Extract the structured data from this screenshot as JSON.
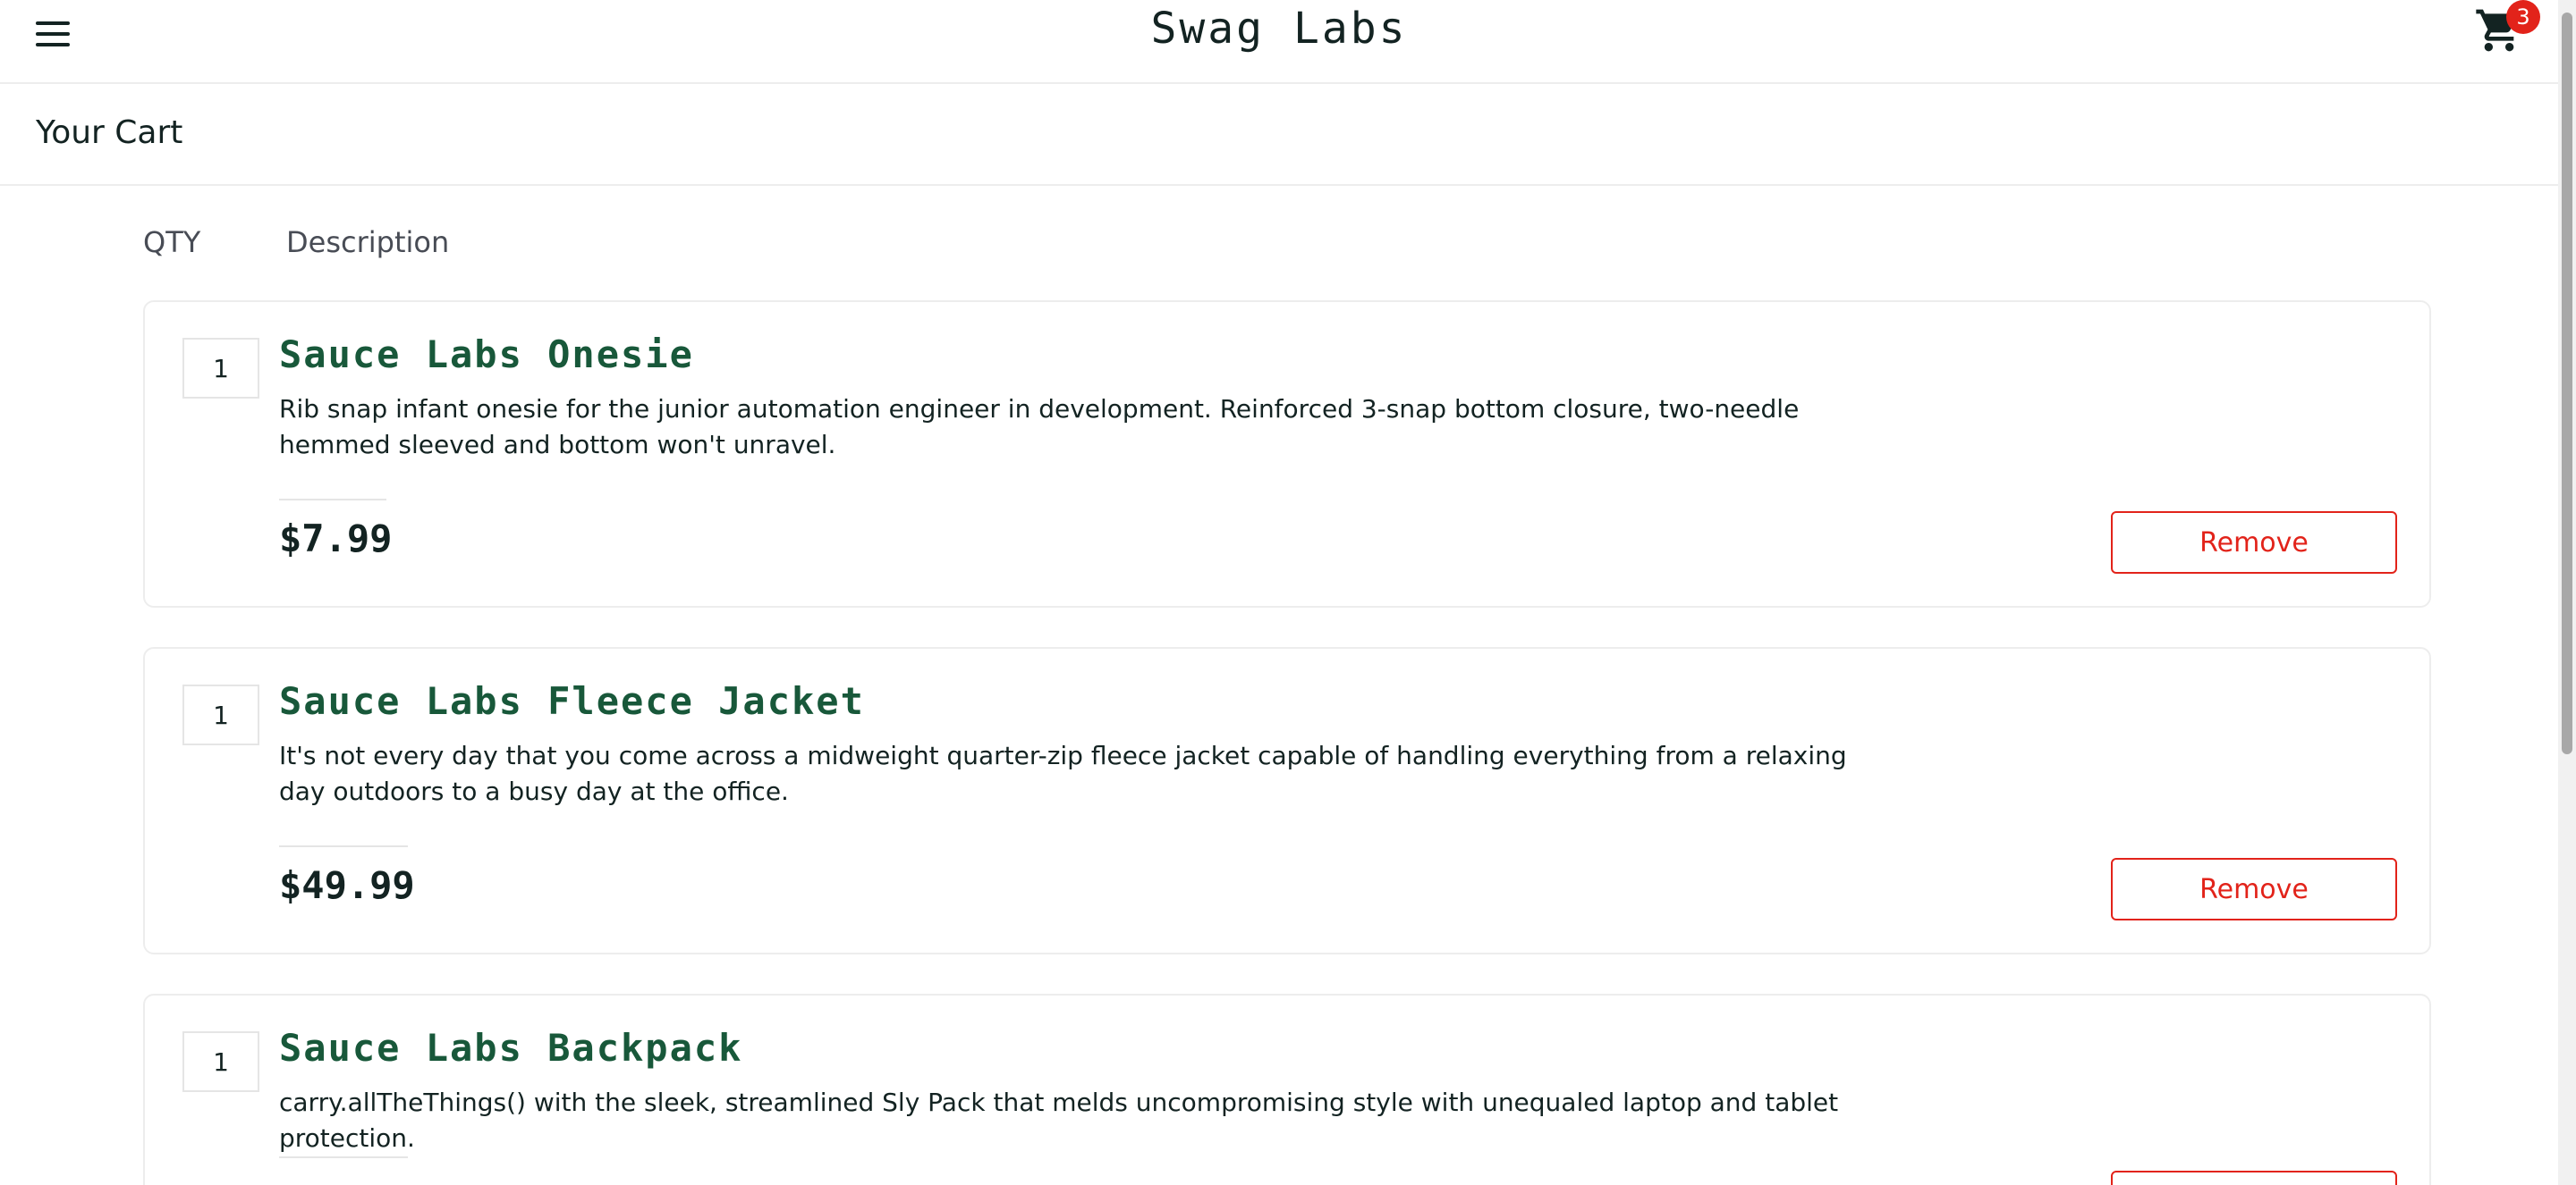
{
  "header": {
    "logo": "Swag Labs",
    "menu_icon": "hamburger-menu-icon",
    "cart_icon": "shopping-cart-icon",
    "cart_badge": "3"
  },
  "page": {
    "title": "Your Cart"
  },
  "columns": {
    "qty": "QTY",
    "description": "Description"
  },
  "cart_items": [
    {
      "qty": "1",
      "name": "Sauce Labs Onesie",
      "description": "Rib snap infant onesie for the junior automation engineer in development. Reinforced 3-snap bottom closure, two-needle hemmed sleeved and bottom won't unravel.",
      "price": "$7.99",
      "remove_label": "Remove"
    },
    {
      "qty": "1",
      "name": "Sauce Labs Fleece Jacket",
      "description": "It's not every day that you come across a midweight quarter-zip fleece jacket capable of handling everything from a relaxing day outdoors to a busy day at the office.",
      "price": "$49.99",
      "remove_label": "Remove"
    },
    {
      "qty": "1",
      "name": "Sauce Labs Backpack",
      "description": "carry.allTheThings() with the sleek, streamlined Sly Pack that melds uncompromising style with unequaled laptop and tablet protection.",
      "price": "",
      "remove_label": ""
    }
  ],
  "colors": {
    "accent_red": "#e2231a",
    "item_name_green": "#18583a",
    "text_dark": "#132322"
  }
}
